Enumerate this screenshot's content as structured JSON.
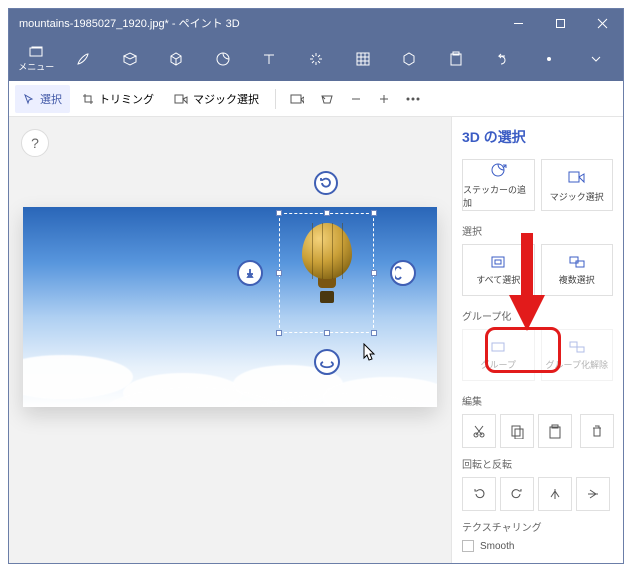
{
  "title": "mountains-1985027_1920.jpg* - ペイント 3D",
  "menu_label": "メニュー",
  "subbar": {
    "select": "選択",
    "trim": "トリミング",
    "magic": "マジック選択"
  },
  "panel": {
    "heading": "3D の選択",
    "add_sticker": "ステッカーの追加",
    "magic_select": "マジック選択",
    "selection_label": "選択",
    "select_all": "すべて選択",
    "multi_select": "複数選択",
    "group_label": "グループ化",
    "group": "グループ",
    "ungroup": "グループ化解除",
    "edit_label": "編集",
    "rotate_label": "回転と反転",
    "texture_label": "テクスチャリング",
    "smooth": "Smooth"
  },
  "help": "?"
}
